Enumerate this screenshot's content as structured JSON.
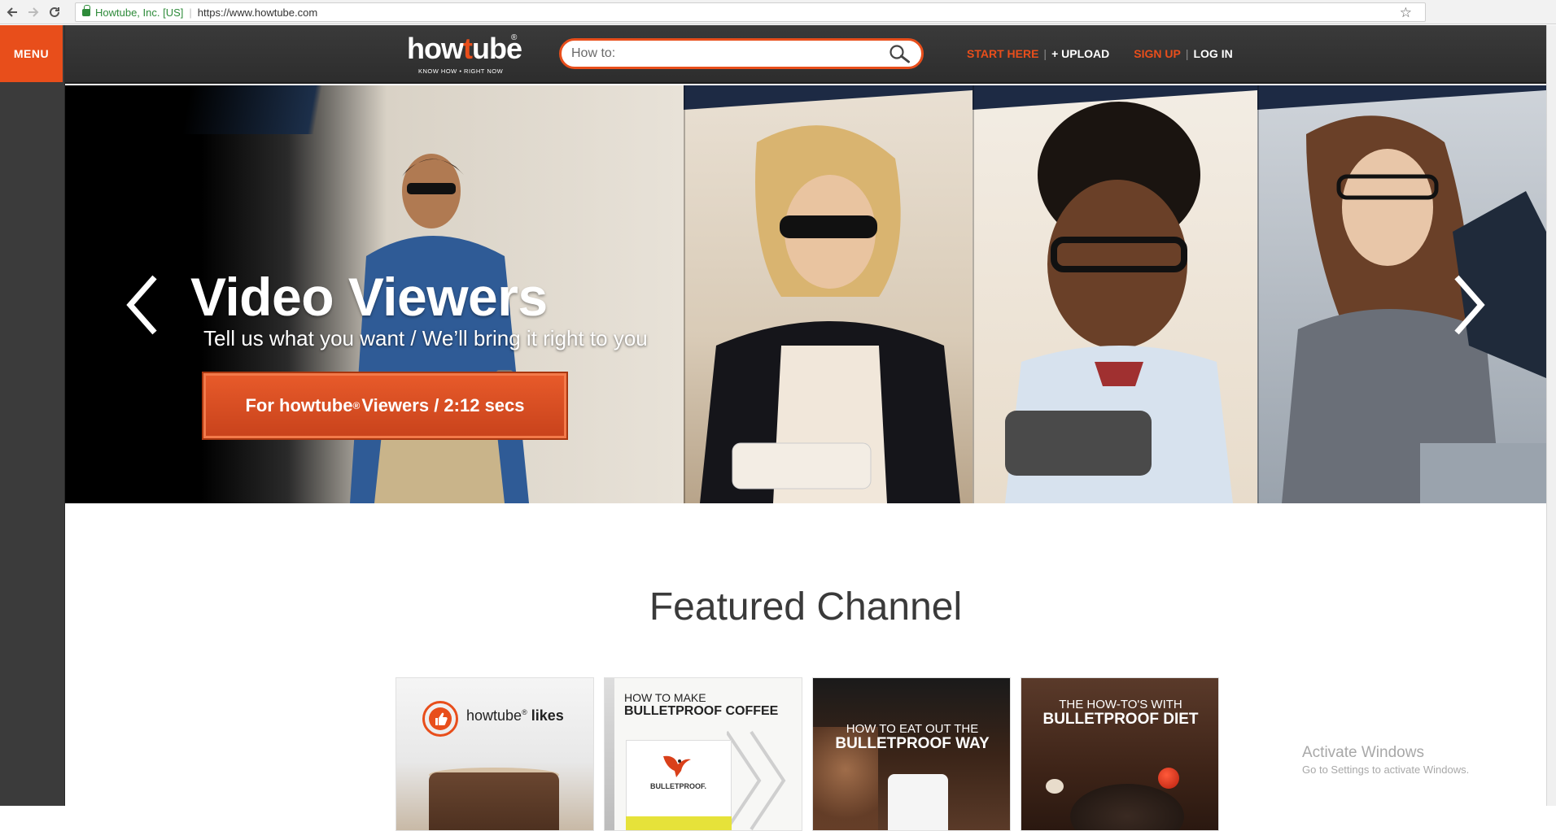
{
  "browser": {
    "back_icon": "back-arrow-icon",
    "forward_icon": "forward-arrow-icon",
    "reload_icon": "reload-icon",
    "security_label": "Howtube, Inc. [US]",
    "separator": "|",
    "url": "https://www.howtube.com",
    "bookmark_icon": "star-icon"
  },
  "sidebar": {
    "menu_label": "MENU"
  },
  "header": {
    "logo": {
      "word_start": "how",
      "word_o": "t",
      "word_end": "ube",
      "registered": "®",
      "tagline": "KNOW HOW • RIGHT NOW"
    },
    "search": {
      "placeholder": "How to:",
      "icon": "search-icon"
    },
    "nav": {
      "start_here": "START HERE",
      "upload": "+ UPLOAD",
      "sign_up": "SIGN UP",
      "log_in": "LOG IN",
      "divider": "|"
    },
    "colors": {
      "accent": "#e84e1b",
      "bar": "#333333"
    }
  },
  "hero": {
    "title": "Video Viewers",
    "subtitle": "Tell us what you want / We’ll bring it right to you",
    "cta_prefix": "For howtube",
    "cta_reg": "®",
    "cta_suffix": " Viewers / 2:12 secs",
    "prev_icon": "chevron-left-icon",
    "next_icon": "chevron-right-icon"
  },
  "featured": {
    "title": "Featured Channel",
    "cards": [
      {
        "brand": "howtube",
        "reg": "®",
        "label": "likes",
        "icon": "thumbs-up-icon"
      },
      {
        "line1": "HOW TO MAKE",
        "line2": "BULLETPROOF COFFEE",
        "bag_label": "BULLETPROOF."
      },
      {
        "line1": "HOW TO EAT OUT THE",
        "line2": "BULLETPROOF WAY"
      },
      {
        "line1": "THE HOW-TO'S WITH",
        "line2": "BULLETPROOF DIET"
      }
    ]
  },
  "overlay": {
    "activate_title": "Activate Windows",
    "activate_sub": "Go to Settings to activate Windows."
  }
}
